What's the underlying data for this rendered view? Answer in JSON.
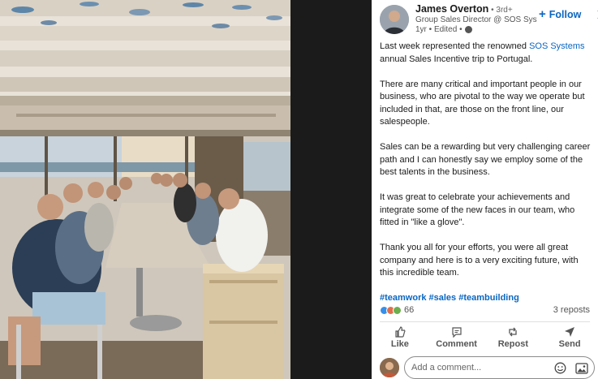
{
  "post": {
    "author": "James Overton",
    "degree": " • 3rd+",
    "subtitle": "Group Sales Director @ SOS Syst...",
    "meta": "1yr • Edited •",
    "follow_label": "Follow",
    "follow_plus": "+",
    "paragraphs": {
      "p1_prefix": "Last week represented the renowned ",
      "p1_link": "SOS Systems",
      "p1_suffix": " annual Sales Incentive trip to Portugal.",
      "p2": "There are many critical and important people in our business, who are pivotal to the way we operate but included in that, are those on the front line, our salespeople.",
      "p3": "Sales can be a rewarding but very challenging career path and I can honestly say we employ some of the best talents in the business.",
      "p4": "It was great to celebrate your achievements and integrate some of the new faces in our team, who fitted in \"like a glove\".",
      "p5": "Thank you all for your efforts, you were all great company and here is to a very exciting future, with this incredible team."
    },
    "hashtags": "#teamwork #sales #teambuilding",
    "reactions_count": "66",
    "reposts": "3 reposts"
  },
  "actions": {
    "like": "Like",
    "comment": "Comment",
    "repost": "Repost",
    "send": "Send"
  },
  "comment_box": {
    "placeholder": "Add a comment..."
  },
  "colors": {
    "accent": "#0a66c2",
    "like_blue": "#378fe9",
    "love_red": "#df704d",
    "celebrate_green": "#6dae4f"
  },
  "icons": [
    "close-icon",
    "globe-icon",
    "like-icon",
    "comment-icon",
    "repost-icon",
    "send-icon",
    "emoji-icon",
    "image-icon"
  ]
}
